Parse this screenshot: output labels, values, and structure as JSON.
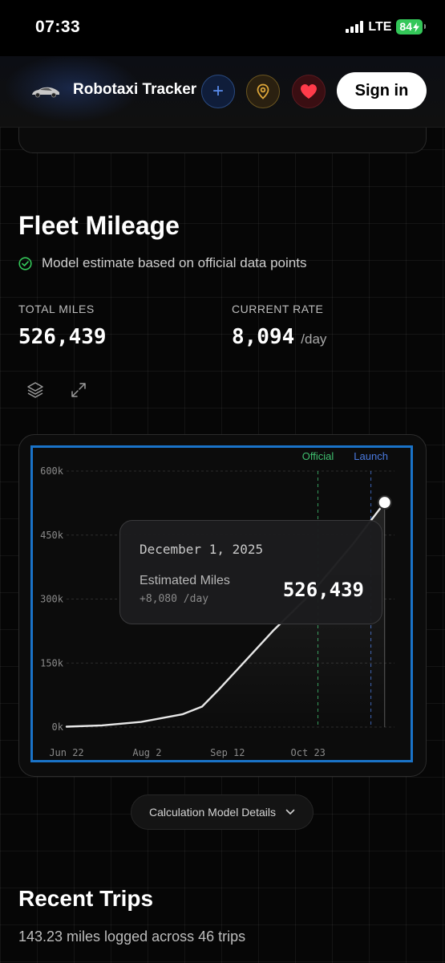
{
  "status_bar": {
    "time": "07:33",
    "network": "LTE",
    "battery": "84"
  },
  "header": {
    "app_title": "Robotaxi Tracker",
    "add_symbol": "+",
    "sign_in_label": "Sign in"
  },
  "fleet": {
    "title": "Fleet Mileage",
    "subtitle": "Model estimate based on official data points",
    "total_label": "TOTAL MILES",
    "total_value": "526,439",
    "rate_label": "CURRENT RATE",
    "rate_value": "8,094",
    "rate_unit": "/day"
  },
  "chart_data": {
    "type": "line",
    "x_tick_labels": [
      "Jun 22",
      "Aug 2",
      "Sep 12",
      "Oct 23"
    ],
    "y_tick_labels": [
      "600k",
      "450k",
      "300k",
      "150k",
      "0k"
    ],
    "ylim": [
      0,
      600000
    ],
    "annotations": [
      {
        "label": "Official",
        "color": "#3fbf6f"
      },
      {
        "label": "Launch",
        "color": "#4a7ae0"
      }
    ],
    "series": [
      {
        "values": [
          {
            "x": "2025-06-22",
            "y": 1000
          },
          {
            "x": "2025-07-10",
            "y": 4000
          },
          {
            "x": "2025-07-30",
            "y": 12000
          },
          {
            "x": "2025-08-20",
            "y": 30000
          },
          {
            "x": "2025-08-30",
            "y": 48000
          },
          {
            "x": "2025-09-08",
            "y": 90000
          },
          {
            "x": "2025-09-20",
            "y": 150000
          },
          {
            "x": "2025-10-05",
            "y": 225000
          },
          {
            "x": "2025-10-25",
            "y": 315000
          },
          {
            "x": "2025-11-15",
            "y": 430000
          },
          {
            "x": "2025-12-01",
            "y": 526439
          }
        ]
      }
    ],
    "grid": true,
    "tooltip": {
      "date": "December 1, 2025",
      "label": "Estimated Miles",
      "rate": "+8,080 /day",
      "value": "526,439"
    }
  },
  "calc_button_label": "Calculation Model Details",
  "trips": {
    "title": "Recent Trips",
    "subtitle": "143.23 miles logged across 46 trips"
  }
}
